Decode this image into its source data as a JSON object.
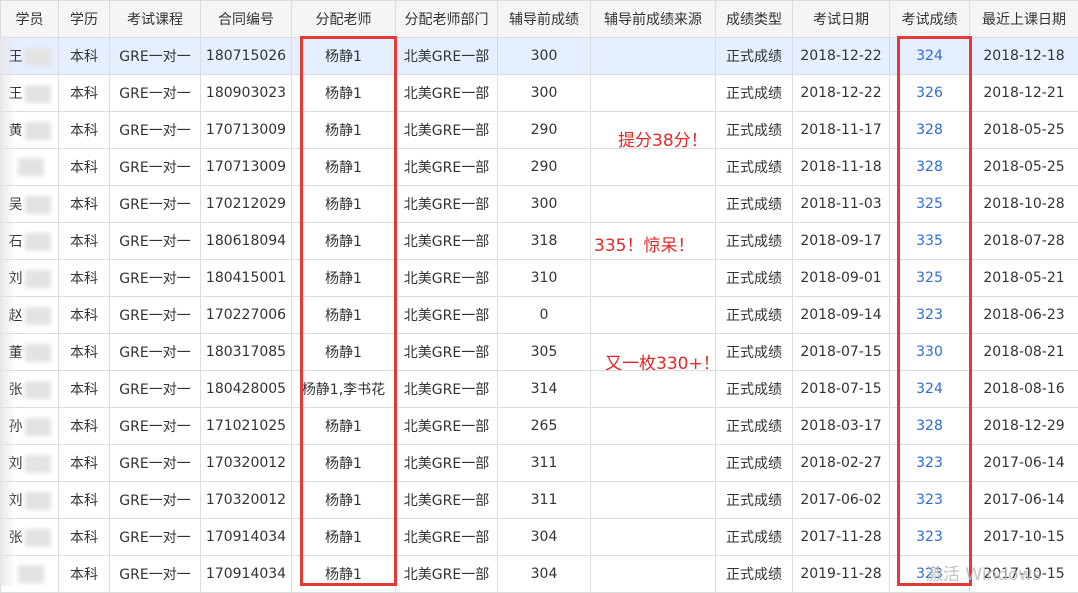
{
  "table": {
    "headers": [
      "学员",
      "学历",
      "考试课程",
      "合同编号",
      "分配老师",
      "分配老师部门",
      "辅导前成绩",
      "辅导前成绩来源",
      "成绩类型",
      "考试日期",
      "考试成绩",
      "最近上课日期"
    ],
    "rows": [
      {
        "name": "王",
        "edu": "本科",
        "course": "GRE一对一",
        "contract": "180715026",
        "teacher": "杨静1",
        "dept": "北美GRE一部",
        "pre": "300",
        "source": "",
        "type": "正式成绩",
        "date": "2018-12-22",
        "score": "324",
        "last": "2018-12-18"
      },
      {
        "name": "王",
        "edu": "本科",
        "course": "GRE一对一",
        "contract": "180903023",
        "teacher": "杨静1",
        "dept": "北美GRE一部",
        "pre": "300",
        "source": "",
        "type": "正式成绩",
        "date": "2018-12-22",
        "score": "326",
        "last": "2018-12-21"
      },
      {
        "name": "黄",
        "edu": "本科",
        "course": "GRE一对一",
        "contract": "170713009",
        "teacher": "杨静1",
        "dept": "北美GRE一部",
        "pre": "290",
        "source": "",
        "type": "正式成绩",
        "date": "2018-11-17",
        "score": "328",
        "last": "2018-05-25"
      },
      {
        "name": "",
        "edu": "本科",
        "course": "GRE一对一",
        "contract": "170713009",
        "teacher": "杨静1",
        "dept": "北美GRE一部",
        "pre": "290",
        "source": "",
        "type": "正式成绩",
        "date": "2018-11-18",
        "score": "328",
        "last": "2018-05-25"
      },
      {
        "name": "吴",
        "edu": "本科",
        "course": "GRE一对一",
        "contract": "170212029",
        "teacher": "杨静1",
        "dept": "北美GRE一部",
        "pre": "300",
        "source": "",
        "type": "正式成绩",
        "date": "2018-11-03",
        "score": "325",
        "last": "2018-10-28"
      },
      {
        "name": "石",
        "edu": "本科",
        "course": "GRE一对一",
        "contract": "180618094",
        "teacher": "杨静1",
        "dept": "北美GRE一部",
        "pre": "318",
        "source": "",
        "type": "正式成绩",
        "date": "2018-09-17",
        "score": "335",
        "last": "2018-07-28"
      },
      {
        "name": "刘",
        "edu": "本科",
        "course": "GRE一对一",
        "contract": "180415001",
        "teacher": "杨静1",
        "dept": "北美GRE一部",
        "pre": "310",
        "source": "",
        "type": "正式成绩",
        "date": "2018-09-01",
        "score": "325",
        "last": "2018-05-21"
      },
      {
        "name": "赵",
        "edu": "本科",
        "course": "GRE一对一",
        "contract": "170227006",
        "teacher": "杨静1",
        "dept": "北美GRE一部",
        "pre": "0",
        "source": "",
        "type": "正式成绩",
        "date": "2018-09-14",
        "score": "323",
        "last": "2018-06-23"
      },
      {
        "name": "董",
        "edu": "本科",
        "course": "GRE一对一",
        "contract": "180317085",
        "teacher": "杨静1",
        "dept": "北美GRE一部",
        "pre": "305",
        "source": "",
        "type": "正式成绩",
        "date": "2018-07-15",
        "score": "330",
        "last": "2018-08-21"
      },
      {
        "name": "张",
        "edu": "本科",
        "course": "GRE一对一",
        "contract": "180428005",
        "teacher": "杨静1,李书花",
        "dept": "北美GRE一部",
        "pre": "314",
        "source": "",
        "type": "正式成绩",
        "date": "2018-07-15",
        "score": "324",
        "last": "2018-08-16"
      },
      {
        "name": "孙",
        "edu": "本科",
        "course": "GRE一对一",
        "contract": "171021025",
        "teacher": "杨静1",
        "dept": "北美GRE一部",
        "pre": "265",
        "source": "",
        "type": "正式成绩",
        "date": "2018-03-17",
        "score": "328",
        "last": "2018-12-29"
      },
      {
        "name": "刘",
        "edu": "本科",
        "course": "GRE一对一",
        "contract": "170320012",
        "teacher": "杨静1",
        "dept": "北美GRE一部",
        "pre": "311",
        "source": "",
        "type": "正式成绩",
        "date": "2018-02-27",
        "score": "323",
        "last": "2017-06-14"
      },
      {
        "name": "刘",
        "edu": "本科",
        "course": "GRE一对一",
        "contract": "170320012",
        "teacher": "杨静1",
        "dept": "北美GRE一部",
        "pre": "311",
        "source": "",
        "type": "正式成绩",
        "date": "2017-06-02",
        "score": "323",
        "last": "2017-06-14"
      },
      {
        "name": "张",
        "edu": "本科",
        "course": "GRE一对一",
        "contract": "170914034",
        "teacher": "杨静1",
        "dept": "北美GRE一部",
        "pre": "304",
        "source": "",
        "type": "正式成绩",
        "date": "2017-11-28",
        "score": "323",
        "last": "2017-10-15"
      },
      {
        "name": "",
        "edu": "本科",
        "course": "GRE一对一",
        "contract": "170914034",
        "teacher": "杨静1",
        "dept": "北美GRE一部",
        "pre": "304",
        "source": "",
        "type": "正式成绩",
        "date": "2019-11-28",
        "score": "323",
        "last": "2017-10-15"
      }
    ]
  },
  "annotations": {
    "a1": "提分38分！",
    "a2": "335！惊呆！",
    "a3": "又一枚330+！"
  },
  "watermark": "激活 Windows",
  "colors": {
    "highlight_box": "#e53935",
    "annotation_text": "#e02828",
    "score_link": "#2f6bd6",
    "selected_row": "#e6efff"
  }
}
